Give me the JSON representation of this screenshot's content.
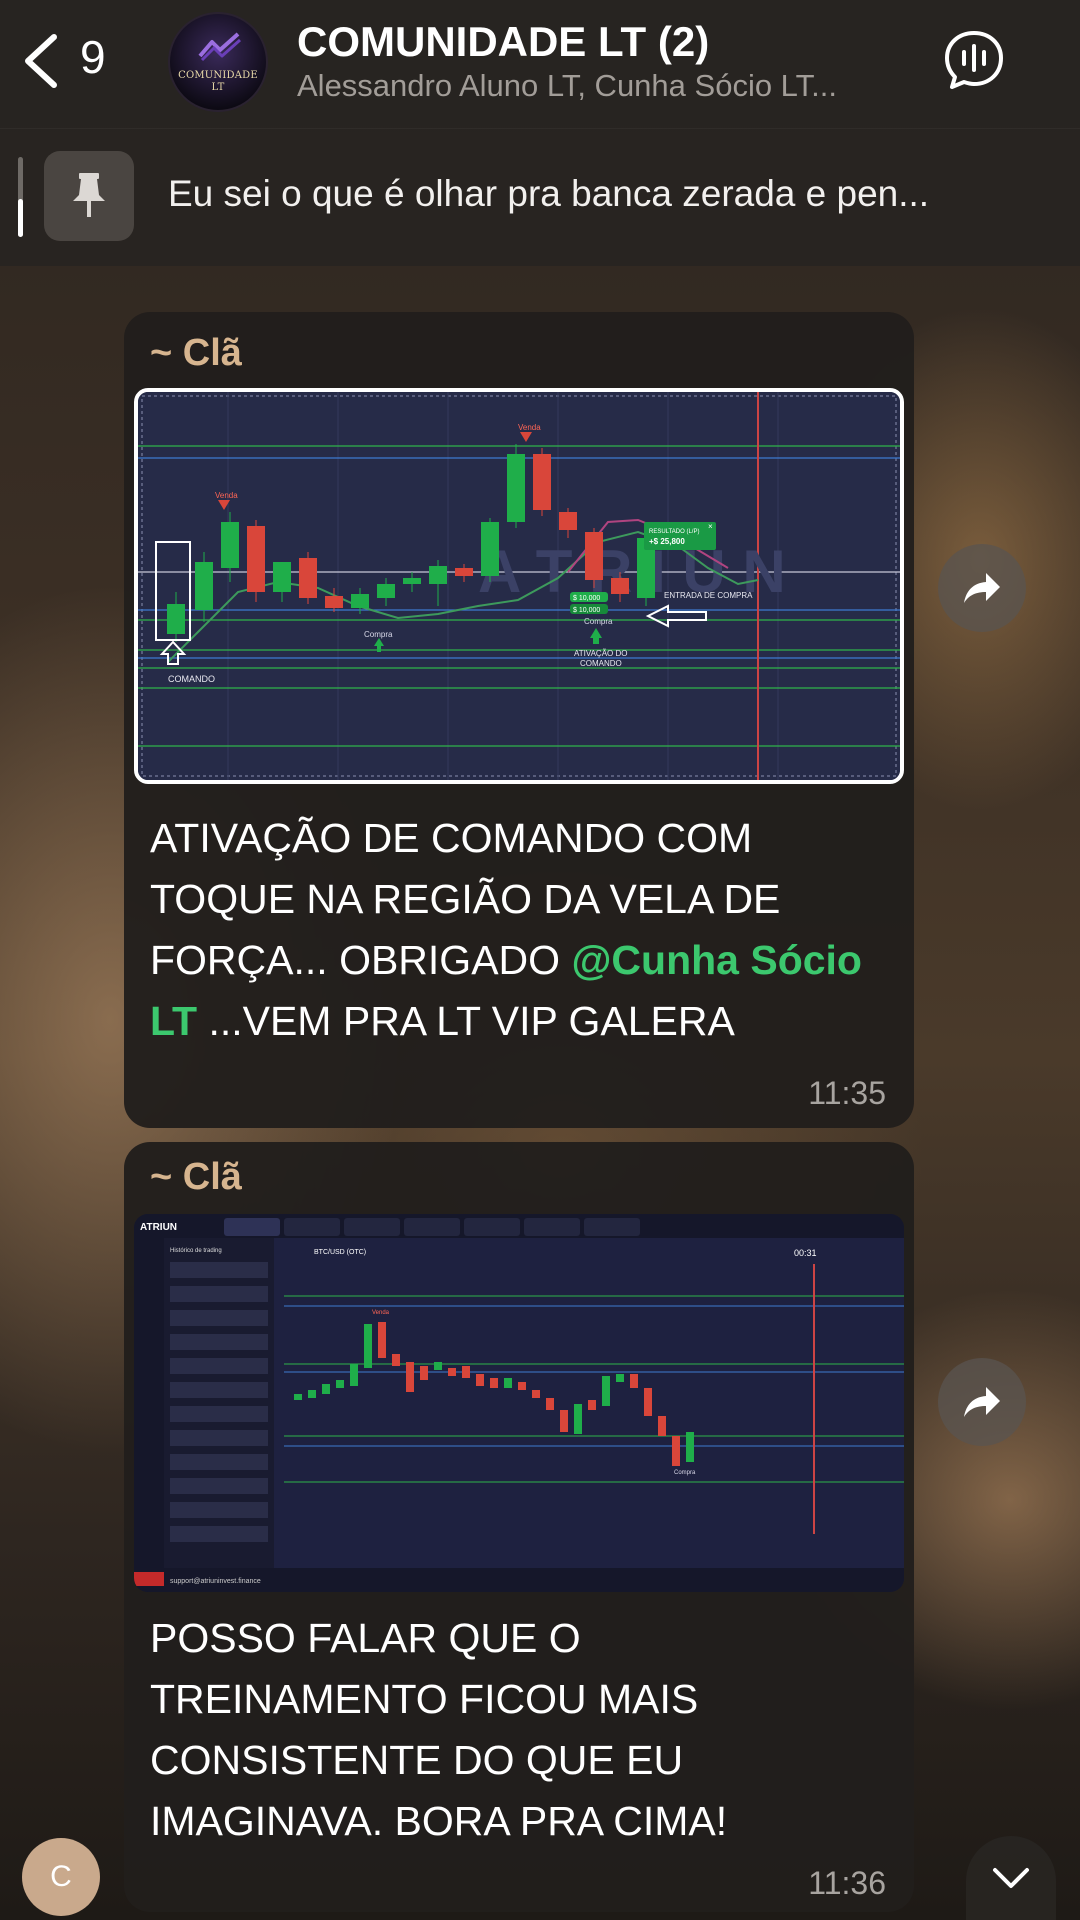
{
  "header": {
    "back_count": "9",
    "title": "COMUNIDADE LT (2)",
    "subtitle": "Alessandro Aluno LT, Cunha Sócio LT...",
    "avatar_text_line1": "COMUNIDADE",
    "avatar_text_line2": "LT"
  },
  "pinned": {
    "text": "Eu sei o que é olhar pra banca zerada e pen..."
  },
  "messages": [
    {
      "sender": "~ Clã",
      "text_before_mention": "ATIVAÇÃO DE COMANDO COM TOQUE NA REGIÃO DA VELA DE FORÇA... OBRIGADO ",
      "mention": "@Cunha Sócio LT",
      "text_after_mention": "  ...VEM PRA LT VIP GALERA",
      "time": "11:35",
      "image": {
        "labels": {
          "venda_1": "Venda",
          "venda_2": "Venda",
          "compra_1": "Compra",
          "compra_2": "Compra",
          "comando": "COMANDO",
          "ativacao_1": "ATIVAÇÃO DO",
          "ativacao_2": "COMANDO",
          "entrada": "ENTRADA DE COMPRA",
          "resultado_title": "RESULTADO (L/P)",
          "resultado_value": "+$ 25,800",
          "chip_1": "$ 10,000",
          "chip_2": "$ 10,000",
          "watermark": "A T R I U N"
        }
      }
    },
    {
      "sender": "~ Clã",
      "text": "POSSO FALAR QUE O TREINAMENTO FICOU MAIS CONSISTENTE DO QUE EU IMAGINAVA. BORA PRA CIMA!",
      "time": "11:36",
      "image": {
        "labels": {
          "brand": "ATRIUN",
          "asset": "BTC/USD (OTC)",
          "history_title": "Histórico de trading",
          "timer": "00:31",
          "support": "support@atriuninvest.finance",
          "venda": "Venda",
          "compra": "Compra"
        }
      }
    }
  ],
  "me_avatar_letter": "C",
  "colors": {
    "accent_green": "#3cc86e",
    "sender": "#d7b58f",
    "bubble": "#211e1c",
    "candle_up": "#1fae4a",
    "candle_down": "#d9463a"
  }
}
